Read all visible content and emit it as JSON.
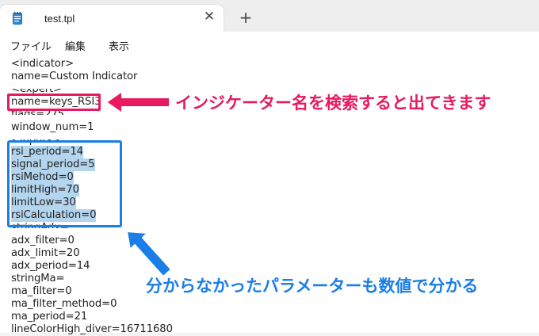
{
  "window": {
    "tab_title": "test.tpl",
    "close_glyph": "✕",
    "new_tab_glyph": "+"
  },
  "menu": {
    "items": [
      "ファイル",
      "編集",
      "表示"
    ]
  },
  "editor": {
    "lines": [
      "<indicator>",
      "name=Custom Indicator",
      "<expert>",
      "name=keys_RSI3",
      "flags=275",
      "window_num=1",
      "<inputs>",
      "rsi_period=14",
      "signal_period=5",
      "rsiMehod=0",
      "limitHigh=70",
      "limitLow=30",
      "rsiCalculation=0",
      "stringAdx=",
      "adx_filter=0",
      "adx_limit=20",
      "adx_period=14",
      "stringMa=",
      "ma_filter=0",
      "ma_filter_method=0",
      "ma_period=21",
      "lineColorHigh_diver=16711680"
    ]
  },
  "annotations": {
    "pink_callout": "インジケーター名を検索すると出てきます",
    "blue_callout": "分からなかったパラメーターも数値で分かる",
    "pink_color": "#e8195f",
    "blue_color": "#1a7ee6",
    "selection_color": "#b4d5ee"
  }
}
